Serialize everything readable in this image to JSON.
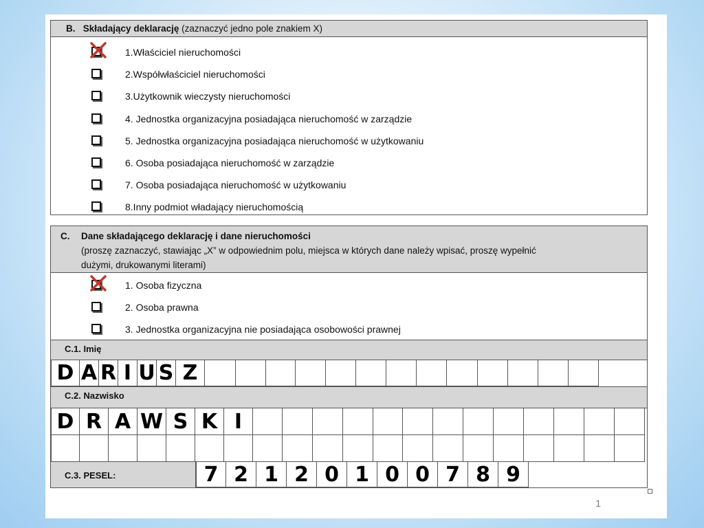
{
  "sectionB": {
    "letter": "B.",
    "title": "Składający deklarację",
    "note": "(zaznaczyć jedno pole znakiem X)",
    "options": [
      {
        "label": "1.Właściciel nieruchomości",
        "checked": true
      },
      {
        "label": "2.Współwłaściciel  nieruchomości",
        "checked": false
      },
      {
        "label": "3.Użytkownik wieczysty nieruchomości",
        "checked": false
      },
      {
        "label": "4. Jednostka organizacyjna posiadająca nieruchomość w zarządzie",
        "checked": false
      },
      {
        "label": "5. Jednostka organizacyjna posiadająca nieruchomość w użytkowaniu",
        "checked": false
      },
      {
        "label": "6. Osoba posiadająca nieruchomość w zarządzie",
        "checked": false
      },
      {
        "label": "7. Osoba posiadająca nieruchomość w użytkowaniu",
        "checked": false
      },
      {
        "label": "8.Inny podmiot władający nieruchomością",
        "checked": false
      }
    ]
  },
  "sectionC": {
    "letter": "C.",
    "title": "Dane składającego deklarację i dane nieruchomości",
    "note_line1": "(proszę zaznaczyć, stawiając „X” w odpowiednim polu, miejsca w których dane należy wpisać, proszę wypełnić",
    "note_line2": "dużymi, drukowanymi literami)",
    "options": [
      {
        "label": "1. Osoba fizyczna",
        "checked": true
      },
      {
        "label": "2. Osoba prawna",
        "checked": false
      },
      {
        "label": "3. Jednostka organizacyjna nie posiadająca osobowości prawnej",
        "checked": false
      }
    ],
    "c1_label": "C.1. Imię",
    "first_name_letters": [
      "D",
      "A",
      "R",
      "I",
      "U",
      "S",
      "Z"
    ],
    "c2_label": "C.2. Nazwisko",
    "last_name_letters": [
      "D",
      "R",
      "A",
      "W",
      "S",
      "K",
      "I"
    ],
    "c3_label": "C.3. PESEL:",
    "pesel_digits": [
      "7",
      "2",
      "1",
      "2",
      "0",
      "1",
      "0",
      "0",
      "7",
      "8",
      "9"
    ]
  },
  "page_number": "1",
  "colors": {
    "header_gray": "#d6d6d6",
    "check_red": "#c0392b",
    "background_blue": "#9fcdf0"
  }
}
